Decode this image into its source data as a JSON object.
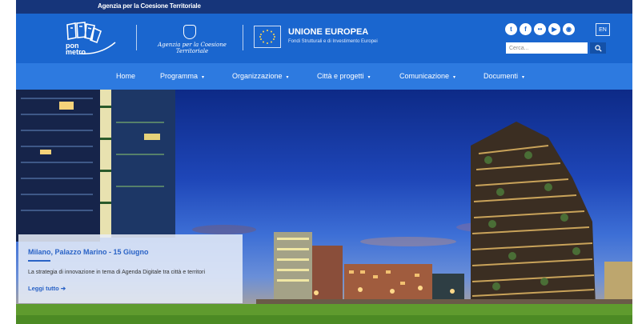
{
  "topbar": {
    "agency": "Agenzia per la Coesione Territoriale"
  },
  "header": {
    "logo": {
      "line1": "pon",
      "line2": "metro"
    },
    "agency_script": "Agenzia per la Coesione Territoriale",
    "eu_title": "UNIONE EUROPEA",
    "eu_subtitle": "Fondi Strutturali e di Investimento Europei",
    "socials": [
      {
        "icon": "twitter-icon",
        "glyph": "t"
      },
      {
        "icon": "facebook-icon",
        "glyph": "f"
      },
      {
        "icon": "flickr-icon",
        "glyph": "••"
      },
      {
        "icon": "youtube-icon",
        "glyph": "▶"
      },
      {
        "icon": "rss-icon",
        "glyph": "◉"
      }
    ],
    "lang": "EN",
    "search_placeholder": "Cerca..."
  },
  "nav": {
    "items": [
      {
        "label": "Home",
        "dropdown": false
      },
      {
        "label": "Programma",
        "dropdown": true
      },
      {
        "label": "Organizzazione",
        "dropdown": true
      },
      {
        "label": "Città e progetti",
        "dropdown": true
      },
      {
        "label": "Comunicazione",
        "dropdown": true
      },
      {
        "label": "Documenti",
        "dropdown": true
      }
    ]
  },
  "slide": {
    "title": "Milano, Palazzo Marino  - 15 Giugno",
    "text": "La strategia di innovazione in tema di Agenda Digitale tra città e territori",
    "link": "Leggi tutto"
  },
  "colors": {
    "topbar": "#16357a",
    "header": "#1a66cf",
    "nav": "#2d7ae0",
    "accent": "#2a63c6"
  }
}
